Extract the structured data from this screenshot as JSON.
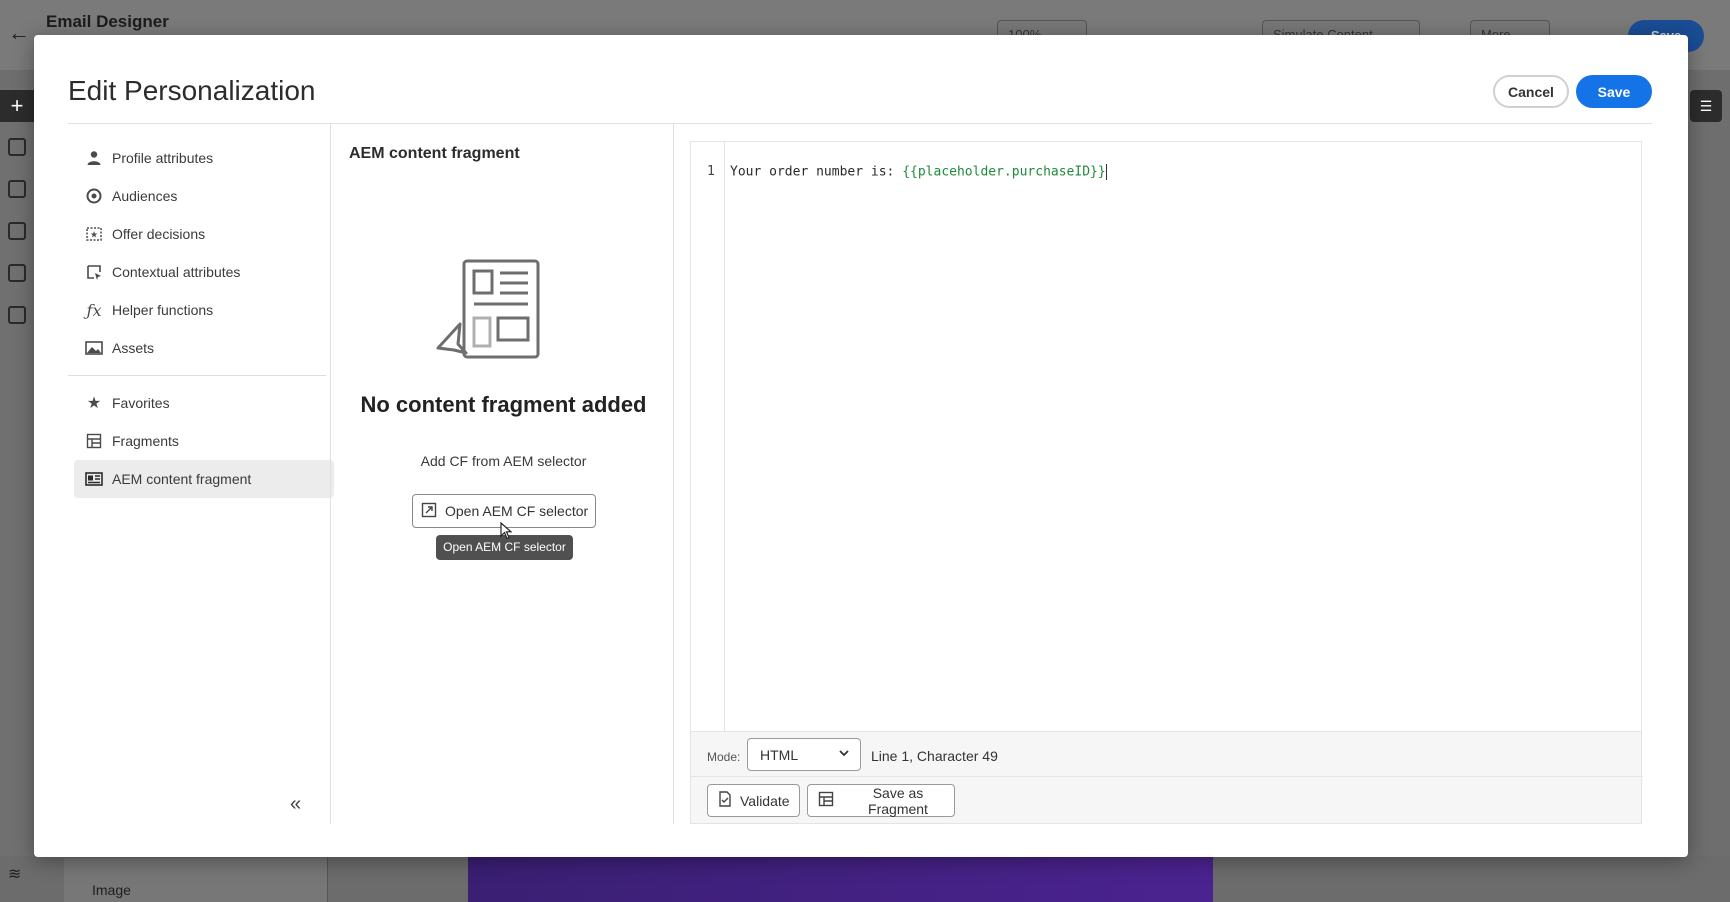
{
  "background": {
    "app_title": "Email Designer",
    "zoom": "100%",
    "simulate_label": "Simulate Content",
    "more_label": "More",
    "save_label": "Save",
    "bottom_item_label": "Image"
  },
  "modal": {
    "title": "Edit Personalization",
    "cancel_label": "Cancel",
    "save_label": "Save"
  },
  "nav": {
    "items": [
      {
        "label": "Profile attributes",
        "icon": "person-icon"
      },
      {
        "label": "Audiences",
        "icon": "audiences-icon"
      },
      {
        "label": "Offer decisions",
        "icon": "offer-icon"
      },
      {
        "label": "Contextual attributes",
        "icon": "contextual-icon"
      },
      {
        "label": "Helper functions",
        "icon": "function-icon"
      },
      {
        "label": "Assets",
        "icon": "image-icon"
      }
    ],
    "secondary_items": [
      {
        "label": "Favorites",
        "icon": "star-icon"
      },
      {
        "label": "Fragments",
        "icon": "fragment-icon"
      },
      {
        "label": "AEM content fragment",
        "icon": "aem-icon",
        "active": true
      }
    ]
  },
  "middle": {
    "title": "AEM content fragment",
    "empty_title": "No content fragment added",
    "empty_subtitle": "Add CF from AEM selector",
    "open_button_label": "Open AEM CF selector",
    "tooltip": "Open AEM CF selector"
  },
  "editor": {
    "line_number": "1",
    "code_prefix": "Your order number is: ",
    "code_expression": "{{placeholder.purchaseID}}",
    "mode_label": "Mode:",
    "mode_value": "HTML",
    "cursor_position": "Line 1, Character 49",
    "validate_label": "Validate",
    "save_fragment_label": "Save as Fragment"
  },
  "colors": {
    "accent": "#1473e6",
    "expression": "#1f8a3b"
  }
}
